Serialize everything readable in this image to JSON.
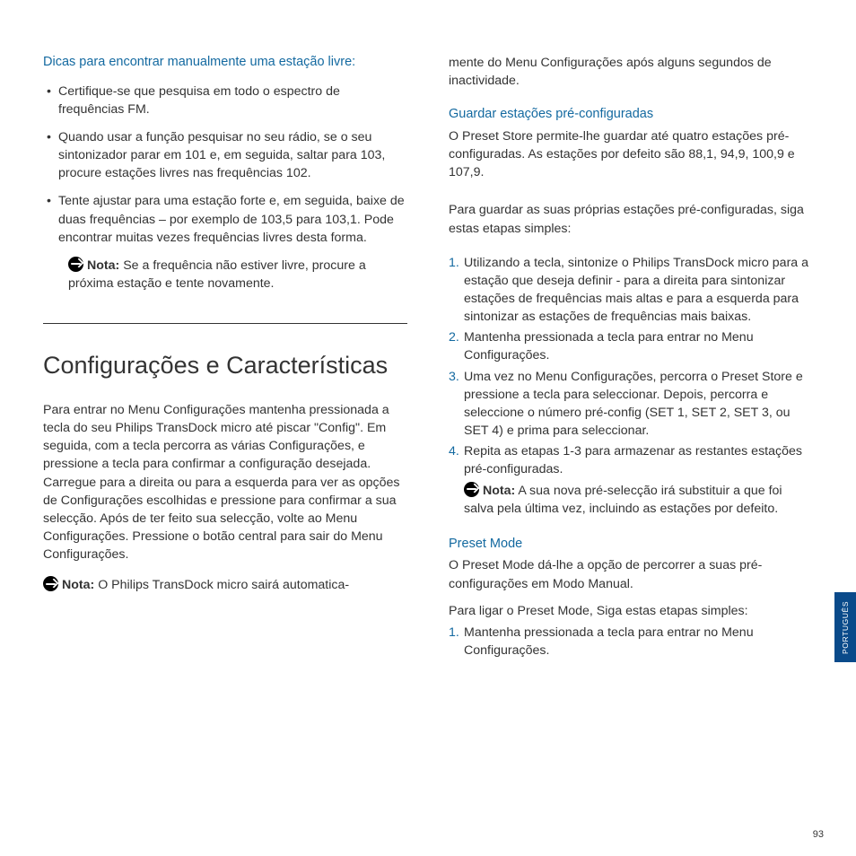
{
  "left": {
    "tipsHeading": "Dicas para encontrar manualmente uma estação livre:",
    "bullets": [
      "Certifique-se que pesquisa em todo o espectro de frequências FM.",
      "Quando usar a função pesquisar no seu rádio, se o seu sintonizador parar em 101 e, em seguida, saltar para 103, procure estações livres nas frequências 102.",
      "Tente ajustar para uma estação forte e, em seguida, baixe de duas frequências – por exemplo de 103,5 para 103,1. Pode encontrar muitas vezes frequências livres desta forma."
    ],
    "noteLabel": "Nota:",
    "noteBody": " Se a frequência não estiver livre, procure a próxima estação e tente novamente.",
    "sectionTitle": "Configurações e Características",
    "introPara": "Para entrar no Menu Configurações mantenha pressionada a tecla do seu Philips TransDock micro até piscar \"Config\". Em seguida, com a tecla percorra as várias Configurações, e pressione a tecla para confirmar a configuração desejada. Carregue para a direita ou para a esquerda para ver as opções de Configurações escolhidas e pressione para confirmar a sua selecção. Após de ter feito sua selecção, volte ao Menu Configurações. Pressione o botão central para sair do Menu Configurações.",
    "note2Label": "Nota: ",
    "note2Body": " O Philips TransDock micro sairá automatica-"
  },
  "right": {
    "contPara": "mente do Menu Configurações após alguns segundos de inactividade.",
    "presetHeading": "Guardar estações pré-configuradas",
    "presetIntro": "O Preset Store permite-lhe guardar até quatro estações pré-configuradas. As estações por defeito são 88,1, 94,9, 100,9 e 107,9.",
    "presetFollow": "Para guardar as suas próprias estações pré-configuradas, siga estas etapas simples:",
    "steps": [
      "Utilizando a tecla, sintonize o Philips TransDock micro para a estação que deseja definir - para a direita para sintonizar estações de frequências mais altas e para a esquerda para sintonizar as estações de frequências mais baixas.",
      "Mantenha pressionada a tecla para entrar no Menu Configurações.",
      "Uma vez no Menu Configurações, percorra o Preset Store e pressione a tecla para seleccionar. Depois, percorra e seleccione o número pré-config (SET 1, SET 2, SET 3, ou SET 4) e prima para seleccionar.",
      "Repita as etapas 1-3 para armazenar as restantes estações pré-configuradas."
    ],
    "stepsNoteLabel": "Nota:",
    "stepsNoteBody": " A sua nova pré-selecção irá substituir a que foi salva pela última vez, incluindo as estações por defeito.",
    "modeHeading": "Preset Mode",
    "modeIntro": "O Preset Mode dá-lhe a opção de percorrer a suas pré-configurações em Modo Manual.",
    "modeFollow": "Para ligar o Preset Mode, Siga estas etapas simples:",
    "modeSteps": [
      "Mantenha pressionada a tecla para entrar no Menu Configurações."
    ]
  },
  "langTab": "PORTUGUÊS",
  "pageNum": "93"
}
